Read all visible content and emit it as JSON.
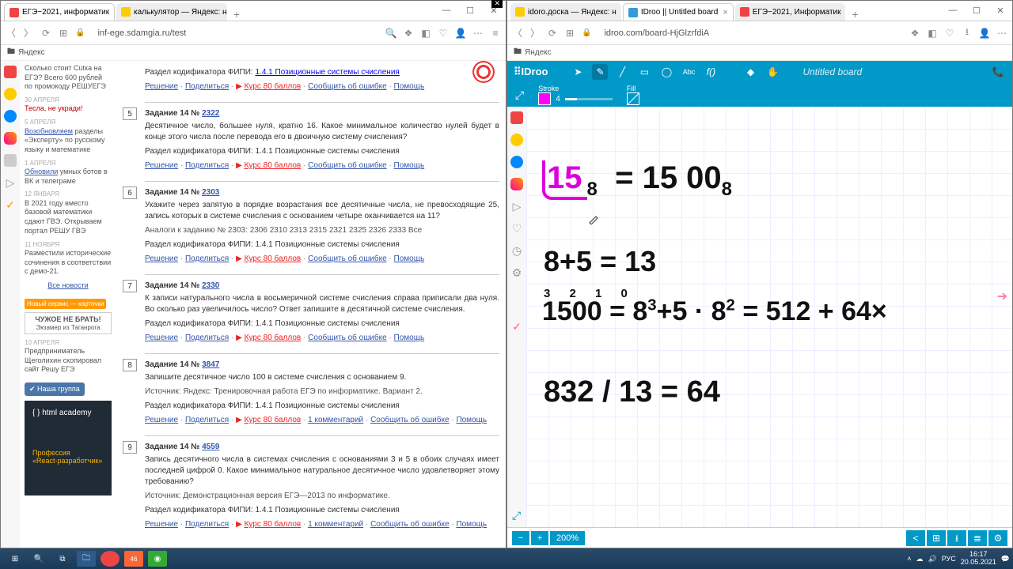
{
  "left": {
    "tabs": [
      {
        "label": "ЕГЭ−2021, информатик",
        "icon": "ico-red",
        "active": true
      },
      {
        "label": "калькулятор — Яндекс: н",
        "icon": "ico-y",
        "active": false
      }
    ],
    "url": "inf-ege.sdamgia.ru/test",
    "bookmark": "Яндекс",
    "sidebar": {
      "promo": "Сколько стоит Cutка на ЕГЭ? Всего 600 рублей по промокоду РЕШУЕГЭ",
      "items": [
        {
          "date": "30 апреля",
          "text": "Тесла, не укради!",
          "cls": "lnk"
        },
        {
          "date": "5 апреля",
          "text": "Возобновляем разделы «Эксперту» по русскому языку и математике"
        },
        {
          "date": "1 апреля",
          "text": "Обновили умных ботов в ВК и телеграме"
        },
        {
          "date": "12 января",
          "text": "В 2021 году вместо базовой математики сдают ГВЭ. Открываем портал РЕШУ ГВЭ"
        },
        {
          "date": "11 ноября",
          "text": "Разместили исторические сочинения в соответствии с демо-21."
        }
      ],
      "allnews": "Все новости",
      "badge": "Новый сервис — карточки",
      "chip_title": "ЧУЖОЕ НЕ БРАТЬ!",
      "chip_sub": "Экзамер из Таганрога",
      "last": {
        "date": "10 апреля",
        "text": "Предприниматель Щеголихин скопировал сайт Решу ЕГЭ"
      },
      "vk": "Наша группа",
      "ad_brand": "{ } html academy",
      "ad_prof": "Профессия",
      "ad_role": "«React-разработчик»"
    },
    "kod_prefix": "Раздел кодификатора ФИПИ: ",
    "kod": "1.4.1 Позиционные системы счисления",
    "actions": {
      "r": "Решение",
      "p": "Поделиться",
      "k": "Курс 80 баллов",
      "e": "Сообщить об ошибке",
      "h": "Помощь",
      "c1": "1 комментарий"
    },
    "tasks": [
      {
        "n": "5",
        "no": "2322",
        "title": "Задание 14 № ",
        "body": "Десятичное число, большее нуля, кратно 16. Какое минимальное количество нулей будет в конце этого числа после перевода его в двоичную систему счисления?",
        "analog": ""
      },
      {
        "n": "6",
        "no": "2303",
        "title": "Задание 14 № ",
        "body": "Укажите через запятую в порядке возрастания все десятичные числа, не превосходящие 25, запись которых в системе счисления с основанием четыре оканчивается на 11?",
        "analog": "Аналоги к заданию № 2303: 2306 2310 2313 2315 2321 2325 2326 2333 Все"
      },
      {
        "n": "7",
        "no": "2330",
        "title": "Задание 14 № ",
        "body": "К записи натурального числа в восьмеричной системе счисления справа приписали два нуля. Во сколько раз увеличилось число? Ответ запишите в десятичной системе счисления.",
        "analog": ""
      },
      {
        "n": "8",
        "no": "3847",
        "title": "Задание 14 № ",
        "body": "Запишите десятичное число 100 в системе счисления с основанием 9.",
        "src": "Источник: Яндекс: Тренировочная работа ЕГЭ по информатике. Вариант 2.",
        "comments": true
      },
      {
        "n": "9",
        "no": "4559",
        "title": "Задание 14 № ",
        "body": "Запись десятичного числа в системах счисления с основаниями 3 и 5 в обоих случаях имеет последней цифрой 0. Какое минимальное натуральное десятичное число удовлетворяет этому требованию?",
        "src": "Источник: Демонстрационная версия ЕГЭ—2013 по информатике.",
        "comments": true
      }
    ]
  },
  "right": {
    "tabs": [
      {
        "label": "idoro.доска — Яндекс: н",
        "icon": "ico-y"
      },
      {
        "label": "IDroo || Untitled board",
        "icon": "ico-b",
        "active": true
      },
      {
        "label": "ЕГЭ−2021, Информатик",
        "icon": "ico-red"
      }
    ],
    "url": "idroo.com/board-HjGlzrfdiA",
    "bookmark": "Яндекс",
    "brand": "⠿IDroo",
    "title": "Untitled board",
    "stroke_lbl": "Stroke",
    "fill_lbl": "Fill",
    "stroke_w": "4",
    "zoom": "200%",
    "hw": {
      "l1a": "15",
      "l1a_sub": "8",
      "l1b": "=  15 00",
      "l1b_sub": "8",
      "l2": "8+5 = 13",
      "l3_sup": "3 2 1 0",
      "l3": "1500 =  8",
      "l3_s1": "3",
      "l3b": "+5 · 8",
      "l3_s2": "2",
      "l3c": " = 512 + 64×",
      "l4": "832 / 13 = 64"
    }
  },
  "taskbar": {
    "tray": {
      "lang": "РУС",
      "time": "16:17",
      "date": "20.05.2021",
      "msgs": "46"
    }
  }
}
